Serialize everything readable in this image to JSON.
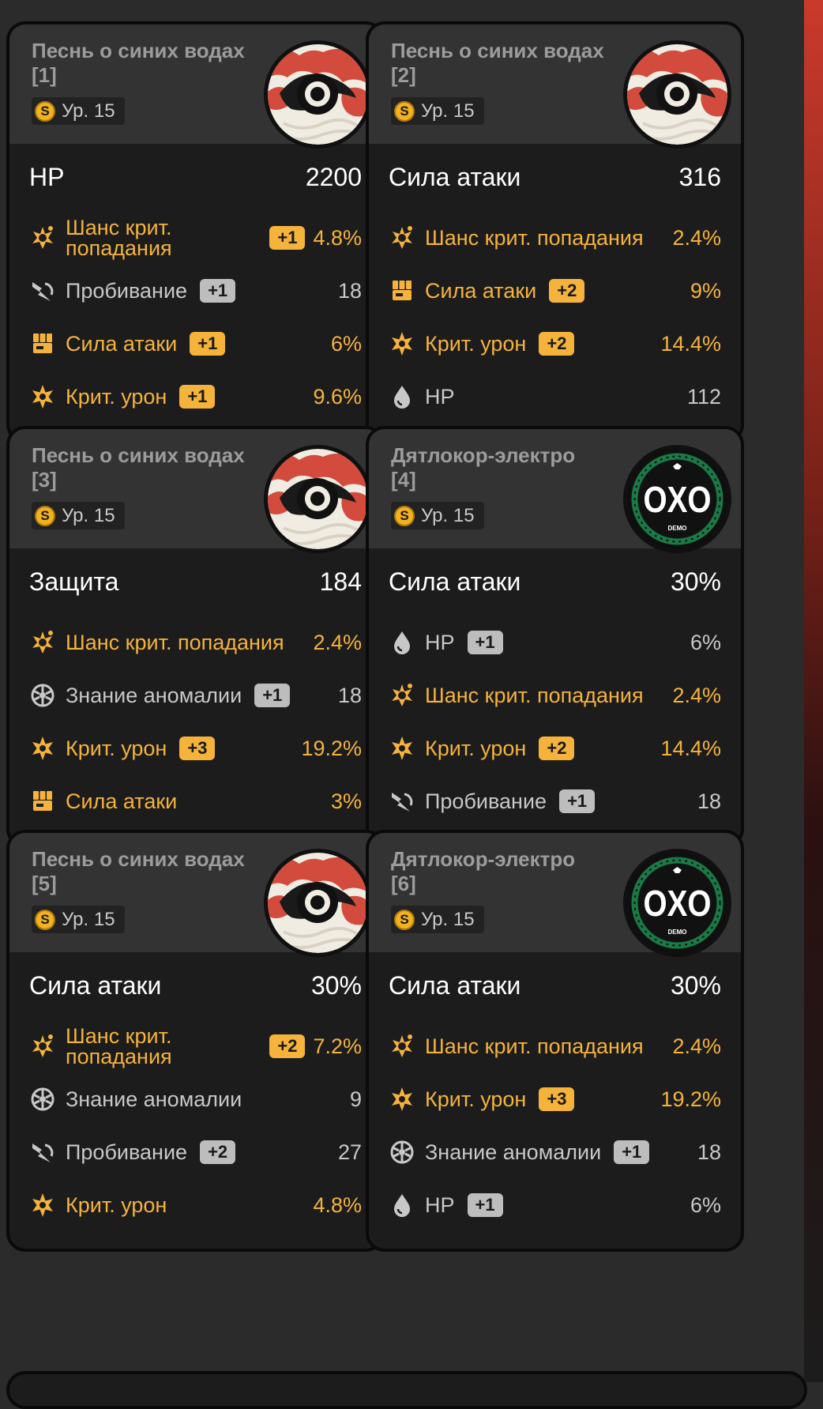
{
  "level_prefix": "Ур.",
  "coin_glyph": "S",
  "colors": {
    "highlight": "#f5b33c",
    "normal": "#c8c8c8",
    "card_bg": "#1c1c1c",
    "header_bg": "#333333",
    "page_bg": "#2b2b2b"
  },
  "discs": [
    {
      "name": "Песнь о синих водах [1]",
      "level": "15",
      "disc_art": "wave-disc",
      "main": {
        "label": "HP",
        "value": "2200"
      },
      "subs": [
        {
          "icon": "crit-rate-icon",
          "label": "Шанс крит. попадания",
          "badge": "+1",
          "value": "4.8%",
          "hl": true
        },
        {
          "icon": "penetration-icon",
          "label": "Пробивание",
          "badge": "+1",
          "value": "18",
          "hl": false
        },
        {
          "icon": "atk-icon",
          "label": "Сила атаки",
          "badge": "+1",
          "value": "6%",
          "hl": true
        },
        {
          "icon": "crit-dmg-icon",
          "label": "Крит. урон",
          "badge": "+1",
          "value": "9.6%",
          "hl": true
        }
      ]
    },
    {
      "name": "Песнь о синих водах [2]",
      "level": "15",
      "disc_art": "wave-disc",
      "main": {
        "label": "Сила атаки",
        "value": "316"
      },
      "subs": [
        {
          "icon": "crit-rate-icon",
          "label": "Шанс крит. попадания",
          "badge": "",
          "value": "2.4%",
          "hl": true
        },
        {
          "icon": "atk-icon",
          "label": "Сила атаки",
          "badge": "+2",
          "value": "9%",
          "hl": true
        },
        {
          "icon": "crit-dmg-icon",
          "label": "Крит. урон",
          "badge": "+2",
          "value": "14.4%",
          "hl": true
        },
        {
          "icon": "hp-icon",
          "label": "HP",
          "badge": "",
          "value": "112",
          "hl": false
        }
      ]
    },
    {
      "name": "Песнь о синих водах [3]",
      "level": "15",
      "disc_art": "wave-disc",
      "main": {
        "label": "Защита",
        "value": "184"
      },
      "subs": [
        {
          "icon": "crit-rate-icon",
          "label": "Шанс крит. попадания",
          "badge": "",
          "value": "2.4%",
          "hl": true
        },
        {
          "icon": "anomaly-icon",
          "label": "Знание аномалии",
          "badge": "+1",
          "value": "18",
          "hl": false
        },
        {
          "icon": "crit-dmg-icon",
          "label": "Крит. урон",
          "badge": "+3",
          "value": "19.2%",
          "hl": true
        },
        {
          "icon": "atk-icon",
          "label": "Сила атаки",
          "badge": "",
          "value": "3%",
          "hl": true
        }
      ]
    },
    {
      "name": "Дятлокор-электро [4]",
      "level": "15",
      "disc_art": "oxo-disc",
      "oxo_text": "OXO",
      "oxo_sub": "DEMO",
      "main": {
        "label": "Сила атаки",
        "value": "30%"
      },
      "subs": [
        {
          "icon": "hp-icon",
          "label": "HP",
          "badge": "+1",
          "value": "6%",
          "hl": false
        },
        {
          "icon": "crit-rate-icon",
          "label": "Шанс крит. попадания",
          "badge": "",
          "value": "2.4%",
          "hl": true
        },
        {
          "icon": "crit-dmg-icon",
          "label": "Крит. урон",
          "badge": "+2",
          "value": "14.4%",
          "hl": true
        },
        {
          "icon": "penetration-icon",
          "label": "Пробивание",
          "badge": "+1",
          "value": "18",
          "hl": false
        }
      ]
    },
    {
      "name": "Песнь о синих водах [5]",
      "level": "15",
      "disc_art": "wave-disc",
      "main": {
        "label": "Сила атаки",
        "value": "30%"
      },
      "subs": [
        {
          "icon": "crit-rate-icon",
          "label": "Шанс крит. попадания",
          "badge": "+2",
          "value": "7.2%",
          "hl": true
        },
        {
          "icon": "anomaly-icon",
          "label": "Знание аномалии",
          "badge": "",
          "value": "9",
          "hl": false
        },
        {
          "icon": "penetration-icon",
          "label": "Пробивание",
          "badge": "+2",
          "value": "27",
          "hl": false
        },
        {
          "icon": "crit-dmg-icon",
          "label": "Крит. урон",
          "badge": "",
          "value": "4.8%",
          "hl": true
        }
      ]
    },
    {
      "name": "Дятлокор-электро [6]",
      "level": "15",
      "disc_art": "oxo-disc",
      "oxo_text": "OXO",
      "oxo_sub": "DEMO",
      "main": {
        "label": "Сила атаки",
        "value": "30%"
      },
      "subs": [
        {
          "icon": "crit-rate-icon",
          "label": "Шанс крит. попадания",
          "badge": "",
          "value": "2.4%",
          "hl": true
        },
        {
          "icon": "crit-dmg-icon",
          "label": "Крит. урон",
          "badge": "+3",
          "value": "19.2%",
          "hl": true
        },
        {
          "icon": "anomaly-icon",
          "label": "Знание аномалии",
          "badge": "+1",
          "value": "18",
          "hl": false
        },
        {
          "icon": "hp-icon",
          "label": "HP",
          "badge": "+1",
          "value": "6%",
          "hl": false
        }
      ]
    }
  ]
}
